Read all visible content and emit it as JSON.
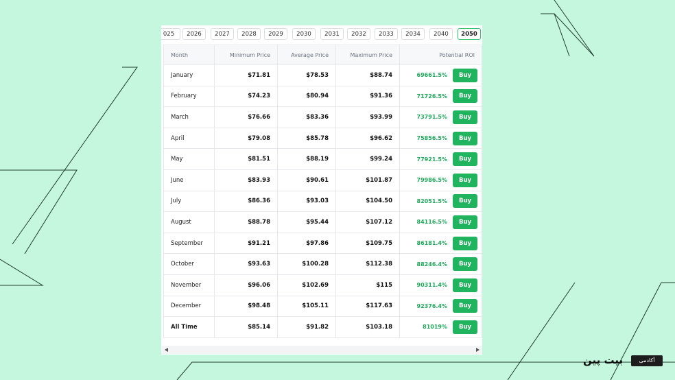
{
  "year_tabs": [
    "025",
    "2026",
    "2027",
    "2028",
    "2029",
    "2030",
    "2031",
    "2032",
    "2033",
    "2034",
    "2040",
    "2050"
  ],
  "active_year": "2050",
  "table": {
    "headers": {
      "month": "Month",
      "min": "Minimum Price",
      "avg": "Average Price",
      "max": "Maximum Price",
      "roi": "Potential ROI"
    },
    "buy_label": "Buy",
    "rows": [
      {
        "month": "January",
        "min": "$71.81",
        "avg": "$78.53",
        "max": "$88.74",
        "roi": "69661.5%"
      },
      {
        "month": "February",
        "min": "$74.23",
        "avg": "$80.94",
        "max": "$91.36",
        "roi": "71726.5%"
      },
      {
        "month": "March",
        "min": "$76.66",
        "avg": "$83.36",
        "max": "$93.99",
        "roi": "73791.5%"
      },
      {
        "month": "April",
        "min": "$79.08",
        "avg": "$85.78",
        "max": "$96.62",
        "roi": "75856.5%"
      },
      {
        "month": "May",
        "min": "$81.51",
        "avg": "$88.19",
        "max": "$99.24",
        "roi": "77921.5%"
      },
      {
        "month": "June",
        "min": "$83.93",
        "avg": "$90.61",
        "max": "$101.87",
        "roi": "79986.5%"
      },
      {
        "month": "July",
        "min": "$86.36",
        "avg": "$93.03",
        "max": "$104.50",
        "roi": "82051.5%"
      },
      {
        "month": "August",
        "min": "$88.78",
        "avg": "$95.44",
        "max": "$107.12",
        "roi": "84116.5%"
      },
      {
        "month": "September",
        "min": "$91.21",
        "avg": "$97.86",
        "max": "$109.75",
        "roi": "86181.4%"
      },
      {
        "month": "October",
        "min": "$93.63",
        "avg": "$100.28",
        "max": "$112.38",
        "roi": "88246.4%"
      },
      {
        "month": "November",
        "min": "$96.06",
        "avg": "$102.69",
        "max": "$115",
        "roi": "90311.4%"
      },
      {
        "month": "December",
        "min": "$98.48",
        "avg": "$105.11",
        "max": "$117.63",
        "roi": "92376.4%"
      },
      {
        "month": "All Time",
        "min": "$85.14",
        "avg": "$91.82",
        "max": "$103.18",
        "roi": "81019%"
      }
    ]
  },
  "brand": {
    "name": "بیت پین",
    "badge": "آکادمی"
  },
  "colors": {
    "background": "#c4f7de",
    "accent": "#21b45f",
    "roi_text": "#1fa85a"
  }
}
